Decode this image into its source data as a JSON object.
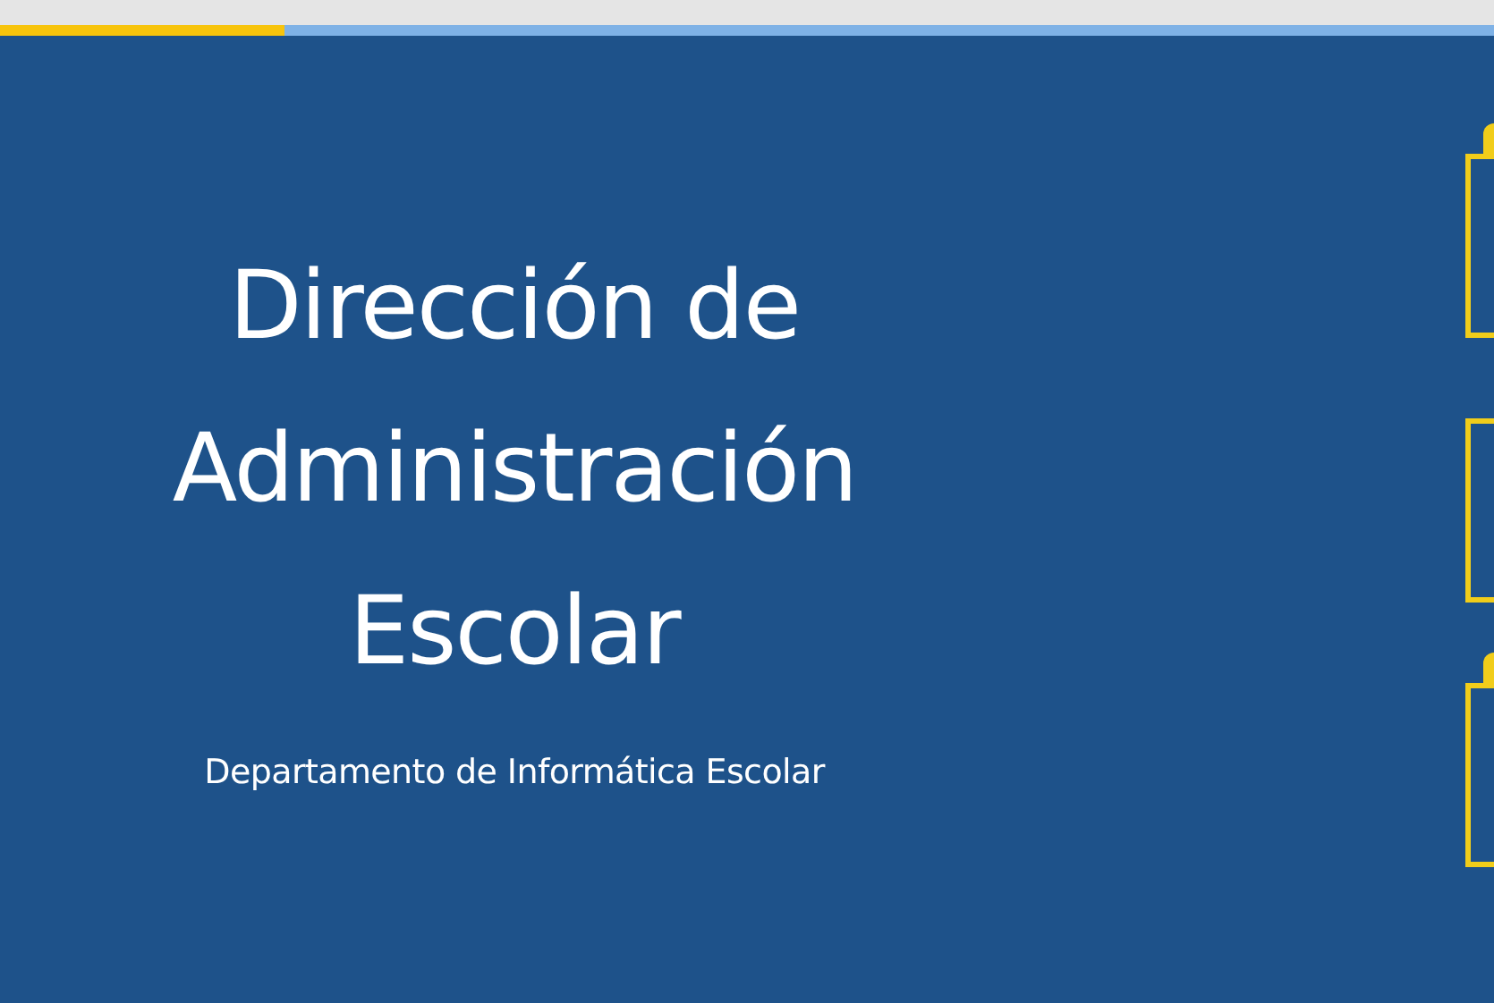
{
  "progress": {
    "level": 0.19
  },
  "hero": {
    "title": "Dirección de Administración Escolar",
    "subtitle": "Departamento de Informática Escolar"
  },
  "cards": [
    {
      "tab": true
    },
    {
      "tab": false
    },
    {
      "tab": true
    }
  ]
}
